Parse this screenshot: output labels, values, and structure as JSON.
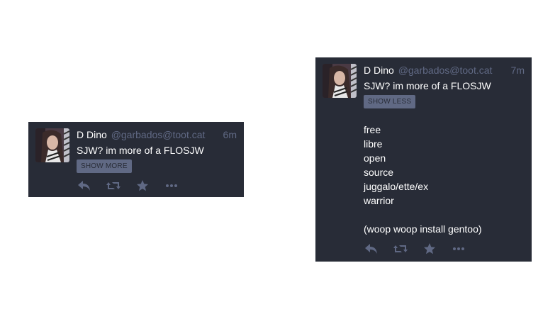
{
  "statuses": [
    {
      "state": "collapsed",
      "author": {
        "display_name": "D Dino",
        "acct": "@garbados@toot.cat"
      },
      "time": "6m",
      "spoiler_text": "SJW? im more of a FLOSJW",
      "toggle_label": "SHOW MORE",
      "body": [],
      "actions": [
        "reply-icon",
        "boost-icon",
        "favourite-icon",
        "more-icon"
      ]
    },
    {
      "state": "expanded",
      "author": {
        "display_name": "D Dino",
        "acct": "@garbados@toot.cat"
      },
      "time": "7m",
      "spoiler_text": "SJW? im more of a FLOSJW",
      "toggle_label": "SHOW LESS",
      "body": [
        "free",
        "libre",
        "open",
        "source",
        "juggalo/ette/ex",
        "warrior",
        "",
        "(woop woop install gentoo)"
      ],
      "actions": [
        "reply-icon",
        "boost-icon",
        "favourite-icon",
        "more-icon"
      ]
    }
  ],
  "colors": {
    "card_bg": "#282c37",
    "muted": "#606984",
    "text": "#ffffff",
    "page_bg": "#ffffff"
  }
}
